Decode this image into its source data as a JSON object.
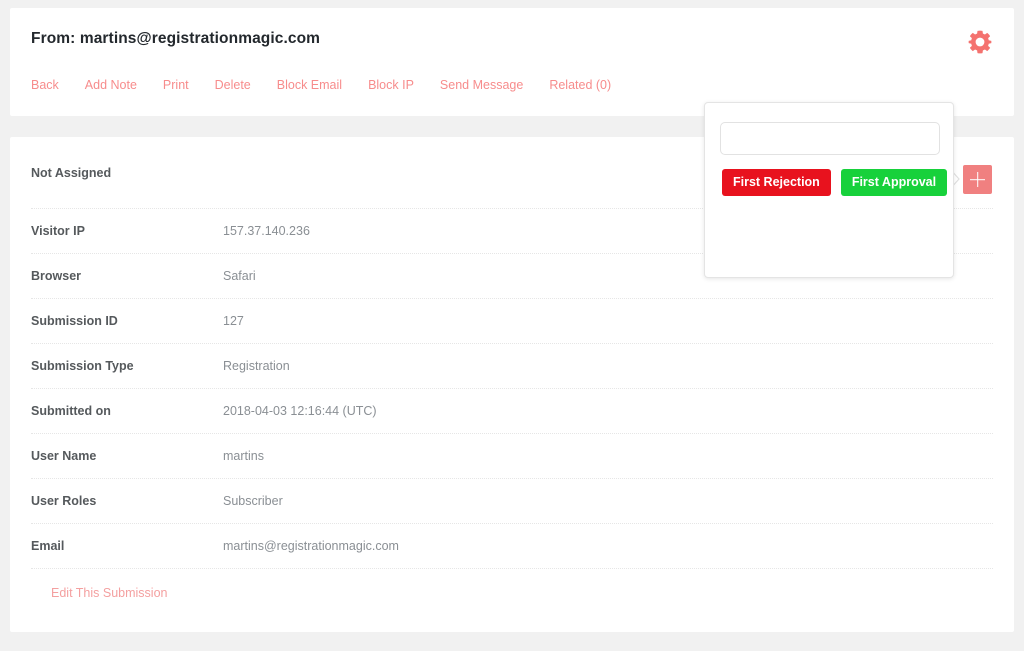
{
  "header": {
    "title": "From: martins@registrationmagic.com",
    "gear_icon": "gear-icon",
    "nav_links": [
      {
        "label": "Back",
        "name": "back"
      },
      {
        "label": "Add Note",
        "name": "add-note"
      },
      {
        "label": "Print",
        "name": "print"
      },
      {
        "label": "Delete",
        "name": "delete"
      },
      {
        "label": "Block Email",
        "name": "block-email"
      },
      {
        "label": "Block IP",
        "name": "block-ip"
      },
      {
        "label": "Send Message",
        "name": "send-message"
      },
      {
        "label": "Related (0)",
        "name": "related"
      }
    ]
  },
  "details": {
    "assignment_status": "Not Assigned",
    "rows": [
      {
        "label": "Visitor IP",
        "value": "157.37.140.236"
      },
      {
        "label": "Browser",
        "value": "Safari"
      },
      {
        "label": "Submission ID",
        "value": "127"
      },
      {
        "label": "Submission Type",
        "value": "Registration"
      },
      {
        "label": "Submitted on",
        "value": "2018-04-03 12:16:44 (UTC)"
      },
      {
        "label": "User Name",
        "value": "martins"
      },
      {
        "label": "User Roles",
        "value": "Subscriber"
      },
      {
        "label": "Email",
        "value": "martins@registrationmagic.com"
      }
    ],
    "edit_link": "Edit This Submission"
  },
  "add_button": {
    "icon": "plus-icon",
    "label": "+"
  },
  "popover": {
    "input_value": "",
    "input_placeholder": "",
    "buttons": [
      {
        "label": "First Rejection",
        "name": "first-rejection",
        "color": "#e8121e"
      },
      {
        "label": "First Approval",
        "name": "first-approval",
        "color": "#17d13b"
      }
    ]
  },
  "colors": {
    "page_background": "#f1f1f1",
    "card_background": "#ffffff",
    "accent_pink": "#f08080",
    "link_pink": "#f78c8c",
    "label_gray": "#55595c",
    "value_gray": "#8a8f94",
    "reject_red": "#e8121e",
    "approve_green": "#17d13b"
  }
}
